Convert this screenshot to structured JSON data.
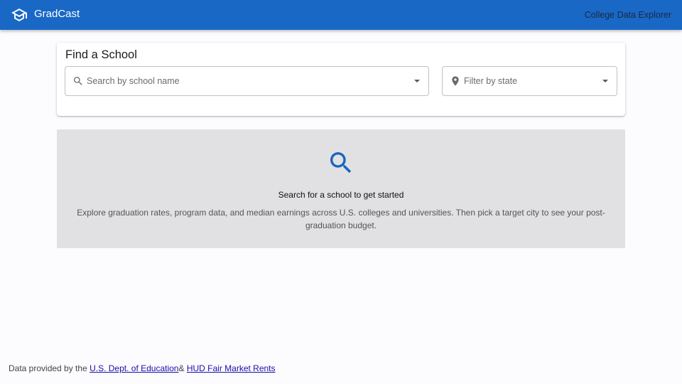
{
  "appbar": {
    "brand": "GradCast",
    "brand_icon": "graduation-cap-icon",
    "right_link": "College Data Explorer",
    "color": "#1968c6"
  },
  "search_card": {
    "title": "Find a School",
    "school_field": {
      "placeholder": "Search by school name",
      "value": "",
      "icon": "search-icon"
    },
    "state_field": {
      "placeholder": "Filter by state",
      "value": "",
      "icon": "location-pin-icon"
    }
  },
  "empty_state": {
    "icon": "search-icon",
    "icon_color": "#1565c0",
    "title": "Search for a school to get started",
    "body": "Explore graduation rates, program data, and median earnings across U.S. colleges and universities. Then pick a target city to see your post-graduation budget."
  },
  "footer": {
    "prefix": "Data provided by the ",
    "link1": "U.S. Dept. of Education",
    "separator": "& ",
    "link2": "HUD Fair Market Rents"
  }
}
